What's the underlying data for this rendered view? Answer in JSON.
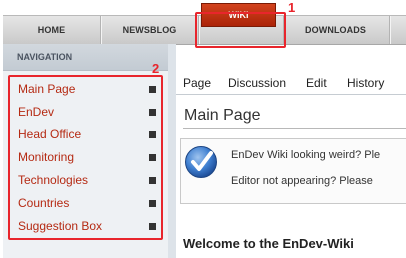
{
  "top_nav": {
    "tabs": [
      {
        "label": "HOME"
      },
      {
        "label": "NEWSBLOG"
      },
      {
        "label": "WIKI",
        "active": true
      },
      {
        "label": "DOWNLOADS"
      }
    ]
  },
  "annotations": {
    "one": "1",
    "two": "2"
  },
  "sidebar": {
    "heading": "NAVIGATION",
    "items": [
      {
        "label": "Main Page"
      },
      {
        "label": "EnDev"
      },
      {
        "label": "Head Office"
      },
      {
        "label": "Monitoring"
      },
      {
        "label": "Technologies"
      },
      {
        "label": "Countries"
      },
      {
        "label": "Suggestion Box"
      }
    ]
  },
  "page_tabs": [
    "Page",
    "Discussion",
    "Edit",
    "History"
  ],
  "main": {
    "title": "Main Page",
    "notice": {
      "line1": "EnDev Wiki looking weird? Ple",
      "line2": "Editor not appearing? Please"
    },
    "welcome": "Welcome to the EnDev-Wiki"
  },
  "colors": {
    "accent_red": "#e8252c",
    "wiki_tab": "#c0330f",
    "link_color": "#b52a13"
  },
  "icons": {
    "notice": "checkmark-circle-icon"
  }
}
